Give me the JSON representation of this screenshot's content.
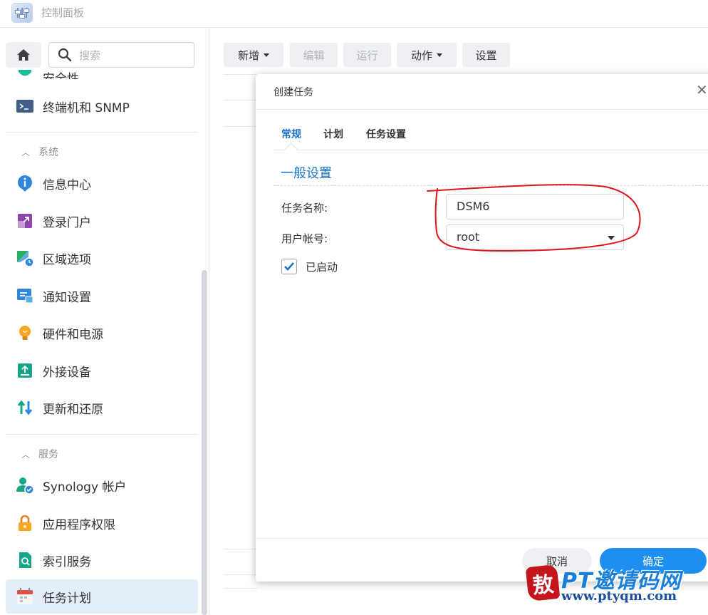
{
  "app": {
    "title": "控制面板"
  },
  "sidebar": {
    "search_placeholder": "搜索",
    "top_items": [
      {
        "label": "安全性",
        "icon": "shield-icon"
      },
      {
        "label": "终端机和 SNMP",
        "icon": "terminal-icon"
      }
    ],
    "sections": [
      {
        "title": "系统",
        "items": [
          {
            "label": "信息中心",
            "icon": "info-icon"
          },
          {
            "label": "登录门户",
            "icon": "login-portal-icon"
          },
          {
            "label": "区域选项",
            "icon": "region-icon"
          },
          {
            "label": "通知设置",
            "icon": "notification-icon"
          },
          {
            "label": "硬件和电源",
            "icon": "bulb-icon"
          },
          {
            "label": "外接设备",
            "icon": "external-device-icon"
          },
          {
            "label": "更新和还原",
            "icon": "update-icon"
          }
        ]
      },
      {
        "title": "服务",
        "items": [
          {
            "label": "Synology 帐户",
            "icon": "account-icon"
          },
          {
            "label": "应用程序权限",
            "icon": "lock-icon"
          },
          {
            "label": "索引服务",
            "icon": "index-icon"
          },
          {
            "label": "任务计划",
            "icon": "calendar-icon",
            "active": true
          }
        ]
      }
    ]
  },
  "toolbar": {
    "buttons": [
      {
        "label": "新增",
        "dropdown": true,
        "enabled": true
      },
      {
        "label": "编辑",
        "dropdown": false,
        "enabled": false
      },
      {
        "label": "运行",
        "dropdown": false,
        "enabled": false
      },
      {
        "label": "动作",
        "dropdown": true,
        "enabled": true
      },
      {
        "label": "设置",
        "dropdown": false,
        "enabled": true
      }
    ]
  },
  "dialog": {
    "title": "创建任务",
    "tabs": [
      {
        "label": "常规",
        "active": true
      },
      {
        "label": "计划",
        "active": false
      },
      {
        "label": "任务设置",
        "active": false
      }
    ],
    "section_title": "一般设置",
    "fields": {
      "task_name": {
        "label": "任务名称:",
        "value": "DSM6"
      },
      "user_account": {
        "label": "用户帐号:",
        "value": "root"
      }
    },
    "enabled": {
      "label": "已启动",
      "checked": true
    },
    "cancel_label": "取消",
    "ok_label": "确定"
  },
  "watermark": {
    "seal_char": "敖",
    "title": "PT邀请码网",
    "url": "www.ptyqm.com"
  },
  "colors": {
    "accent": "#1a73c9",
    "primary_button": "#1f8ef1",
    "annotation": "#e0151b",
    "active_nav_bg": "#e3eef9"
  }
}
